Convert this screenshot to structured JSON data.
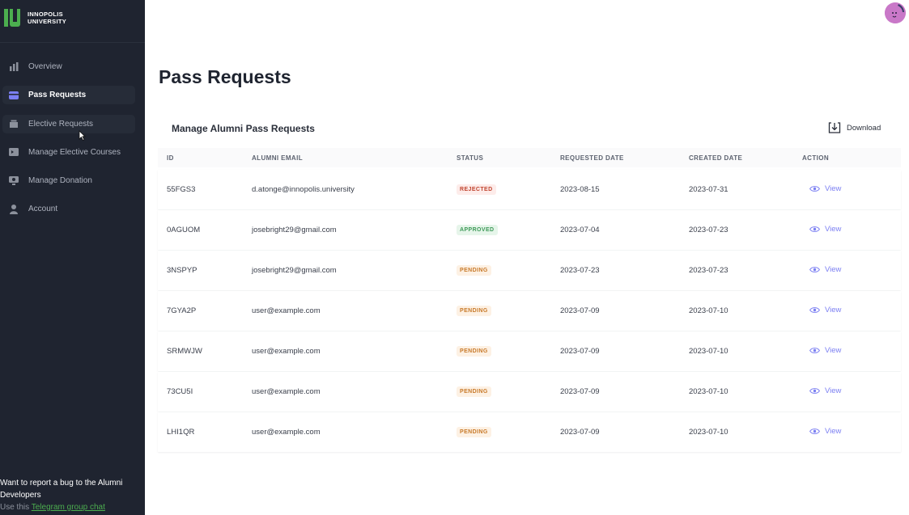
{
  "brand": {
    "line1": "INNOPOLIS",
    "line2": "UNIVERSITY",
    "color": "#4cae4f"
  },
  "sidebar": {
    "items": [
      {
        "label": "Overview",
        "icon": "bar-chart-icon"
      },
      {
        "label": "Pass Requests",
        "icon": "card-icon"
      },
      {
        "label": "Elective Requests",
        "icon": "folder-icon"
      },
      {
        "label": "Manage Elective Courses",
        "icon": "courses-icon"
      },
      {
        "label": "Manage Donation",
        "icon": "donation-icon"
      },
      {
        "label": "Account",
        "icon": "user-icon"
      }
    ],
    "active_index": 1,
    "footer": {
      "line1": "Want to report a bug to the Alumni",
      "line2": "Developers",
      "prefix": "Use this",
      "link": "Telegram group chat"
    }
  },
  "page": {
    "title": "Pass Requests",
    "card_title": "Manage Alumni Pass Requests",
    "download_label": "Download"
  },
  "table": {
    "headers": {
      "id": "ID",
      "email": "ALUMNI EMAIL",
      "status": "STATUS",
      "requested": "REQUESTED DATE",
      "created": "CREATED DATE",
      "action": "ACTION"
    },
    "rows": [
      {
        "id": "55FGS3",
        "email": "d.atonge@innopolis.university",
        "status": "REJECTED",
        "requested": "2023-08-15",
        "created": "2023-07-31",
        "action": "View"
      },
      {
        "id": "0AGUOM",
        "email": "josebright29@gmail.com",
        "status": "APPROVED",
        "requested": "2023-07-04",
        "created": "2023-07-23",
        "action": "View"
      },
      {
        "id": "3NSPYP",
        "email": "josebright29@gmail.com",
        "status": "PENDING",
        "requested": "2023-07-23",
        "created": "2023-07-23",
        "action": "View"
      },
      {
        "id": "7GYA2P",
        "email": "user@example.com",
        "status": "PENDING",
        "requested": "2023-07-09",
        "created": "2023-07-10",
        "action": "View"
      },
      {
        "id": "SRMWJW",
        "email": "user@example.com",
        "status": "PENDING",
        "requested": "2023-07-09",
        "created": "2023-07-10",
        "action": "View"
      },
      {
        "id": "73CU5I",
        "email": "user@example.com",
        "status": "PENDING",
        "requested": "2023-07-09",
        "created": "2023-07-10",
        "action": "View"
      },
      {
        "id": "LHI1QR",
        "email": "user@example.com",
        "status": "PENDING",
        "requested": "2023-07-09",
        "created": "2023-07-10",
        "action": "View"
      }
    ]
  },
  "colors": {
    "sidebar_bg": "#1f2430",
    "accent": "#7b7ff2",
    "rejected": "#c0452f",
    "approved": "#3e9a58",
    "pending": "#c87a2a"
  }
}
